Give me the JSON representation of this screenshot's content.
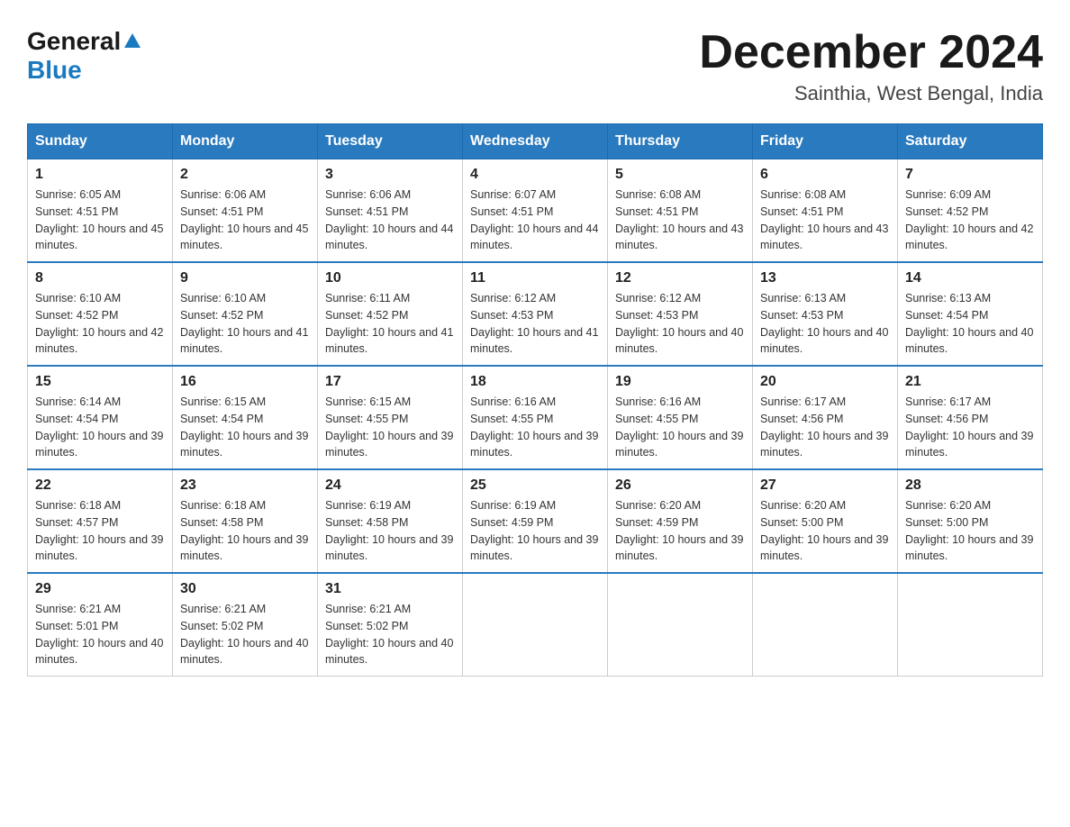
{
  "header": {
    "logo_general": "General",
    "logo_blue": "Blue",
    "month_title": "December 2024",
    "subtitle": "Sainthia, West Bengal, India"
  },
  "days_of_week": [
    "Sunday",
    "Monday",
    "Tuesday",
    "Wednesday",
    "Thursday",
    "Friday",
    "Saturday"
  ],
  "weeks": [
    [
      {
        "day": "1",
        "sunrise": "6:05 AM",
        "sunset": "4:51 PM",
        "daylight": "10 hours and 45 minutes."
      },
      {
        "day": "2",
        "sunrise": "6:06 AM",
        "sunset": "4:51 PM",
        "daylight": "10 hours and 45 minutes."
      },
      {
        "day": "3",
        "sunrise": "6:06 AM",
        "sunset": "4:51 PM",
        "daylight": "10 hours and 44 minutes."
      },
      {
        "day": "4",
        "sunrise": "6:07 AM",
        "sunset": "4:51 PM",
        "daylight": "10 hours and 44 minutes."
      },
      {
        "day": "5",
        "sunrise": "6:08 AM",
        "sunset": "4:51 PM",
        "daylight": "10 hours and 43 minutes."
      },
      {
        "day": "6",
        "sunrise": "6:08 AM",
        "sunset": "4:51 PM",
        "daylight": "10 hours and 43 minutes."
      },
      {
        "day": "7",
        "sunrise": "6:09 AM",
        "sunset": "4:52 PM",
        "daylight": "10 hours and 42 minutes."
      }
    ],
    [
      {
        "day": "8",
        "sunrise": "6:10 AM",
        "sunset": "4:52 PM",
        "daylight": "10 hours and 42 minutes."
      },
      {
        "day": "9",
        "sunrise": "6:10 AM",
        "sunset": "4:52 PM",
        "daylight": "10 hours and 41 minutes."
      },
      {
        "day": "10",
        "sunrise": "6:11 AM",
        "sunset": "4:52 PM",
        "daylight": "10 hours and 41 minutes."
      },
      {
        "day": "11",
        "sunrise": "6:12 AM",
        "sunset": "4:53 PM",
        "daylight": "10 hours and 41 minutes."
      },
      {
        "day": "12",
        "sunrise": "6:12 AM",
        "sunset": "4:53 PM",
        "daylight": "10 hours and 40 minutes."
      },
      {
        "day": "13",
        "sunrise": "6:13 AM",
        "sunset": "4:53 PM",
        "daylight": "10 hours and 40 minutes."
      },
      {
        "day": "14",
        "sunrise": "6:13 AM",
        "sunset": "4:54 PM",
        "daylight": "10 hours and 40 minutes."
      }
    ],
    [
      {
        "day": "15",
        "sunrise": "6:14 AM",
        "sunset": "4:54 PM",
        "daylight": "10 hours and 39 minutes."
      },
      {
        "day": "16",
        "sunrise": "6:15 AM",
        "sunset": "4:54 PM",
        "daylight": "10 hours and 39 minutes."
      },
      {
        "day": "17",
        "sunrise": "6:15 AM",
        "sunset": "4:55 PM",
        "daylight": "10 hours and 39 minutes."
      },
      {
        "day": "18",
        "sunrise": "6:16 AM",
        "sunset": "4:55 PM",
        "daylight": "10 hours and 39 minutes."
      },
      {
        "day": "19",
        "sunrise": "6:16 AM",
        "sunset": "4:55 PM",
        "daylight": "10 hours and 39 minutes."
      },
      {
        "day": "20",
        "sunrise": "6:17 AM",
        "sunset": "4:56 PM",
        "daylight": "10 hours and 39 minutes."
      },
      {
        "day": "21",
        "sunrise": "6:17 AM",
        "sunset": "4:56 PM",
        "daylight": "10 hours and 39 minutes."
      }
    ],
    [
      {
        "day": "22",
        "sunrise": "6:18 AM",
        "sunset": "4:57 PM",
        "daylight": "10 hours and 39 minutes."
      },
      {
        "day": "23",
        "sunrise": "6:18 AM",
        "sunset": "4:58 PM",
        "daylight": "10 hours and 39 minutes."
      },
      {
        "day": "24",
        "sunrise": "6:19 AM",
        "sunset": "4:58 PM",
        "daylight": "10 hours and 39 minutes."
      },
      {
        "day": "25",
        "sunrise": "6:19 AM",
        "sunset": "4:59 PM",
        "daylight": "10 hours and 39 minutes."
      },
      {
        "day": "26",
        "sunrise": "6:20 AM",
        "sunset": "4:59 PM",
        "daylight": "10 hours and 39 minutes."
      },
      {
        "day": "27",
        "sunrise": "6:20 AM",
        "sunset": "5:00 PM",
        "daylight": "10 hours and 39 minutes."
      },
      {
        "day": "28",
        "sunrise": "6:20 AM",
        "sunset": "5:00 PM",
        "daylight": "10 hours and 39 minutes."
      }
    ],
    [
      {
        "day": "29",
        "sunrise": "6:21 AM",
        "sunset": "5:01 PM",
        "daylight": "10 hours and 40 minutes."
      },
      {
        "day": "30",
        "sunrise": "6:21 AM",
        "sunset": "5:02 PM",
        "daylight": "10 hours and 40 minutes."
      },
      {
        "day": "31",
        "sunrise": "6:21 AM",
        "sunset": "5:02 PM",
        "daylight": "10 hours and 40 minutes."
      },
      null,
      null,
      null,
      null
    ]
  ],
  "labels": {
    "sunrise": "Sunrise:",
    "sunset": "Sunset:",
    "daylight": "Daylight:"
  }
}
